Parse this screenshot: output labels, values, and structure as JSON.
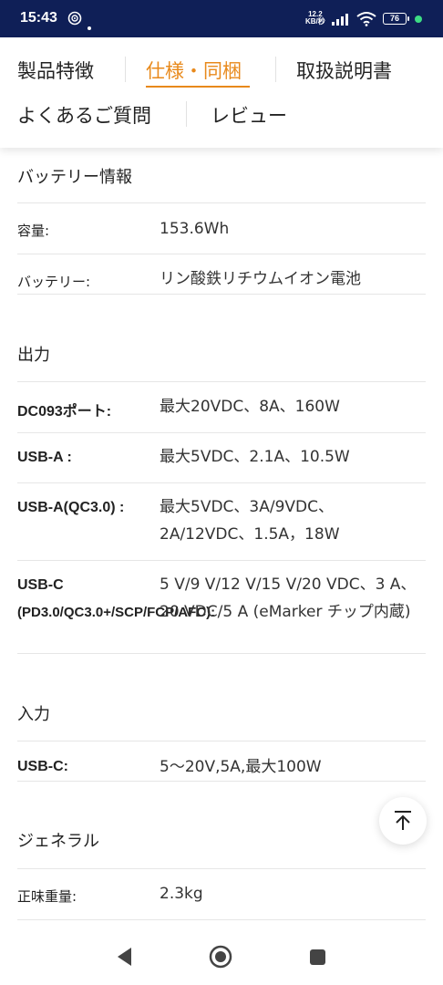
{
  "status_bar": {
    "time": "15:43",
    "net_speed_value": "12.2",
    "net_speed_unit": "KB/秒",
    "battery": "76"
  },
  "tabs": [
    {
      "label": "製品特徴",
      "active": false
    },
    {
      "label": "仕様・同梱",
      "active": true
    },
    {
      "label": "取扱説明書",
      "active": false
    },
    {
      "label": "よくあるご質問",
      "active": false
    },
    {
      "label": "レビュー",
      "active": false
    }
  ],
  "sections": {
    "battery": {
      "title": "バッテリー情報",
      "rows": [
        {
          "label": "容量:",
          "value": "153.6Wh"
        },
        {
          "label": "バッテリー:",
          "value": "リン酸鉄リチウムイオン電池"
        }
      ]
    },
    "output": {
      "title": "出力",
      "rows": [
        {
          "label": "DC093ポート:",
          "value": "最大20VDC、8A、160W"
        },
        {
          "label": "USB-A :",
          "value": "最大5VDC、2.1A、10.5W"
        },
        {
          "label": "USB-A(QC3.0) :",
          "value": "最大5VDC、3A/9VDC、2A/12VDC、1.5A，18W"
        },
        {
          "label_line1": "USB-C",
          "label_line2": "(PD3.0/QC3.0+/SCP/FCP/AFC):",
          "value": "5 V/9 V/12 V/15 V/20 VDC、3 A、20 VDC/5 A (eMarker チップ内蔵)"
        }
      ]
    },
    "input": {
      "title": "入力",
      "rows": [
        {
          "label": "USB-C:",
          "value": "5～20V,5A,最大100W"
        }
      ]
    },
    "general": {
      "title": "ジェネラル",
      "rows": [
        {
          "label": "正味重量:",
          "value": "2.3kg"
        }
      ]
    }
  },
  "icons": {
    "scroll_top": "arrow-up-to-line-icon",
    "nav_back": "back-triangle-icon",
    "nav_home": "home-circle-icon",
    "nav_recents": "recents-square-icon"
  },
  "colors": {
    "status_bar_bg": "#0f1f57",
    "accent": "#e8891b"
  }
}
